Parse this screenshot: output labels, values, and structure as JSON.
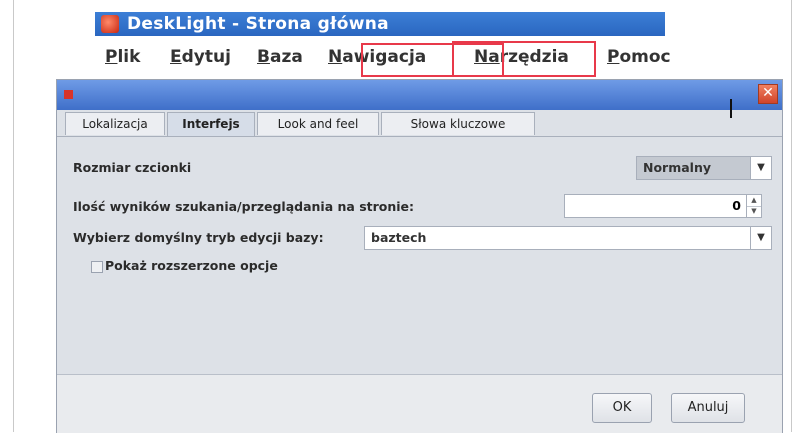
{
  "app": {
    "title": "DeskLight - Strona główna",
    "menu": [
      {
        "mnemonic": "P",
        "rest": "lik"
      },
      {
        "mnemonic": "E",
        "rest": "dytuj"
      },
      {
        "mnemonic": "B",
        "rest": "aza"
      },
      {
        "mnemonic": "N",
        "rest": "awigacja"
      },
      {
        "mnemonic": "Na",
        "rest": "rzędzia"
      },
      {
        "mnemonic": "P",
        "rest": "omoc"
      }
    ],
    "highlight_color": "#e8394a"
  },
  "dialog": {
    "close_glyph": "✕",
    "tabs": [
      "Lokalizacja",
      "Interfejs",
      "Look and feel",
      "Słowa kluczowe"
    ],
    "active_tab": "Interfejs",
    "font_size": {
      "label": "Rozmiar czcionki",
      "value": "Normalny"
    },
    "results_per_page": {
      "label": "Ilość wyników szukania/przeglądania na stronie:",
      "value": "0"
    },
    "edit_mode": {
      "label": "Wybierz domyślny tryb edycji bazy:",
      "value": "baztech"
    },
    "extended_options": {
      "label": "Pokaż rozszerzone opcje",
      "checked": false
    },
    "buttons": {
      "ok": "OK",
      "cancel": "Anuluj"
    }
  }
}
